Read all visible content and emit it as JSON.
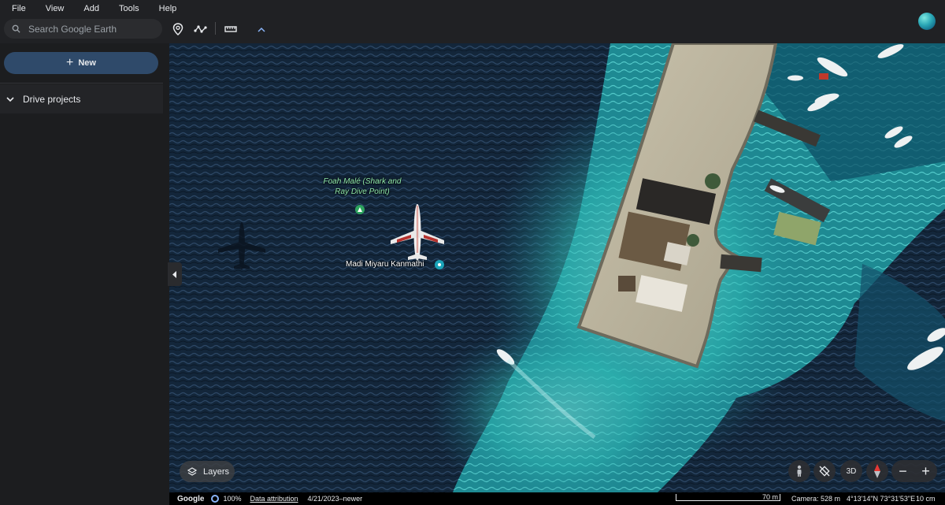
{
  "menu": [
    "File",
    "View",
    "Add",
    "Tools",
    "Help"
  ],
  "search": {
    "placeholder": "Search Google Earth"
  },
  "toolbar": {
    "icons": [
      "place-pin-icon",
      "path-icon",
      "ruler-icon",
      "chevron-up-icon"
    ]
  },
  "sidebar": {
    "new_label": "New",
    "drive_projects_label": "Drive projects"
  },
  "map": {
    "labels": {
      "dive_point": "Foah Malé (Shark and Ray Dive Point)",
      "plane": "Madi Miyaru Kanmathi"
    },
    "layers_label": "Layers",
    "three_d_label": "3D",
    "zoom_out": "−",
    "zoom_in": "+"
  },
  "status": {
    "brand": "Google",
    "stream_percent": "100%",
    "attribution": "Data attribution",
    "imagery_date": "4/21/2023–newer",
    "scale": "70 m",
    "camera": "Camera: 528 m",
    "coordinates": "4°13'14\"N 73°31'53\"E",
    "eye_alt": "10 cm"
  },
  "colors": {
    "accent": "#2f4a6a",
    "deep_water": "#0f2236",
    "reef": "#2fb7b3",
    "pin_green": "#2ea45f",
    "pin_teal": "#1aa3b8"
  }
}
